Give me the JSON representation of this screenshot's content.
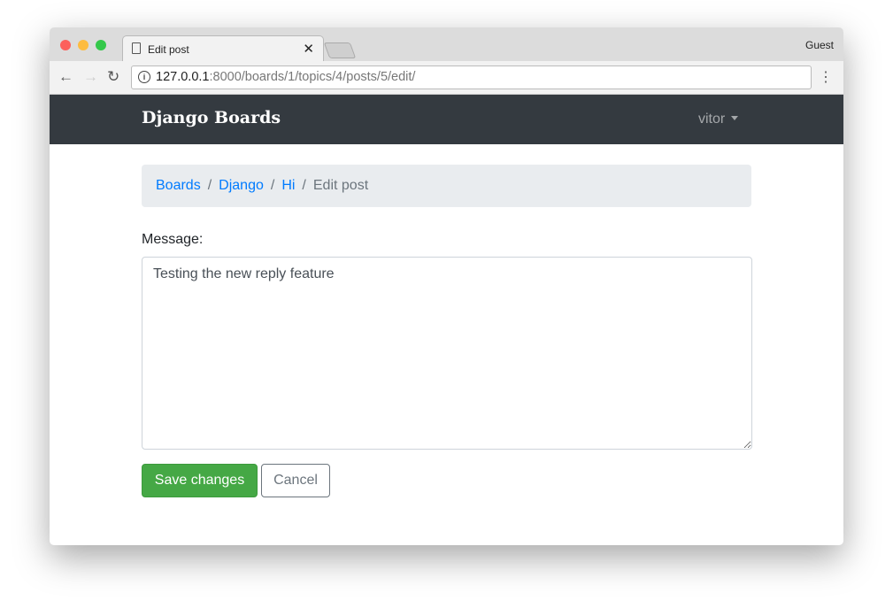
{
  "browser": {
    "tab_title": "Edit post",
    "profile": "Guest",
    "url_host": "127.0.0.1",
    "url_rest": ":8000/boards/1/topics/4/posts/5/edit/"
  },
  "navbar": {
    "brand": "Django Boards",
    "user": "vitor"
  },
  "breadcrumb": {
    "items": [
      "Boards",
      "Django",
      "Hi"
    ],
    "current": "Edit post",
    "separator": "/"
  },
  "form": {
    "message_label": "Message:",
    "message_value": "Testing the new reply feature",
    "save_label": "Save changes",
    "cancel_label": "Cancel"
  }
}
